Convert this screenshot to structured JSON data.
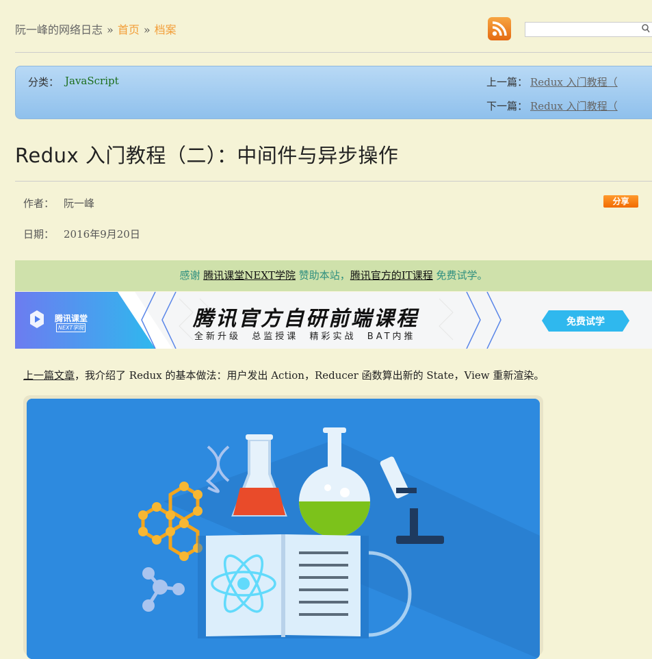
{
  "header": {
    "site_name": "阮一峰的网络日志",
    "separator": "»",
    "home": "首页",
    "archive": "档案",
    "search_placeholder": ""
  },
  "category_box": {
    "category_label": "分类：",
    "category": "JavaScript",
    "prev_label": "上一篇：",
    "prev_title": "Redux 入门教程（",
    "next_label": "下一篇：",
    "next_title": "Redux 入门教程（"
  },
  "article": {
    "title": "Redux 入门教程（二）：中间件与异步操作",
    "author_label": "作者：",
    "author": "阮一峰",
    "date_label": "日期：",
    "date": "2016年9月20日",
    "share_label": "分享"
  },
  "sponsor": {
    "thanks": "感谢",
    "sponsor_name": "腾讯课堂NEXT学院",
    "middle": "赞助本站，",
    "course": "腾讯官方的IT课程",
    "tail": "免费试学。"
  },
  "banner": {
    "logo_text": "腾讯课堂",
    "logo_sub": "NEXT学院",
    "headline": "腾讯官方自研前端课程",
    "subline": "全新升级  总监授课  精彩实战  BAT内推",
    "cta": "免费试学"
  },
  "body": {
    "intro_link": "上一篇文章",
    "intro_text": "，我介绍了 Redux 的基本做法：用户发出 Action，Reducer 函数算出新的 State，View 重新渲染。"
  },
  "colors": {
    "background": "#f5f3d6",
    "link_orange": "#f29d38",
    "category_green": "#1b6d1b",
    "sponsor_bg": "#cfe1ab",
    "banner_accent": "#2fb8ee",
    "illustration_bg": "#2d8adf"
  },
  "icons": {
    "rss": "rss-feed-icon",
    "search": "search-icon"
  }
}
